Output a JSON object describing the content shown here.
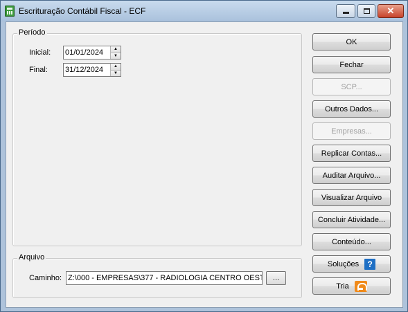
{
  "window": {
    "title": "Escrituração Contábil Fiscal - ECF",
    "close_glyph": "✕"
  },
  "periodo": {
    "legend": "Período",
    "inicial_label": "Inicial:",
    "inicial_value": "01/01/2024",
    "final_label": "Final:",
    "final_value": "31/12/2024"
  },
  "arquivo": {
    "legend": "Arquivo",
    "caminho_label": "Caminho:",
    "caminho_value": "Z:\\000 - EMPRESAS\\377 - RADIOLOGIA CENTRO OEST",
    "browse_label": "..."
  },
  "buttons": {
    "ok": "OK",
    "fechar": "Fechar",
    "scp": "SCP...",
    "outros_dados": "Outros Dados...",
    "empresas": "Empresas...",
    "replicar_contas": "Replicar Contas...",
    "auditar_arquivo": "Auditar Arquivo...",
    "visualizar_arquivo": "Visualizar Arquivo",
    "concluir_atividade": "Concluir Atividade...",
    "conteudo": "Conteúdo...",
    "solucoes": "Soluções",
    "tria": "Tria"
  },
  "icons": {
    "help_glyph": "?"
  }
}
